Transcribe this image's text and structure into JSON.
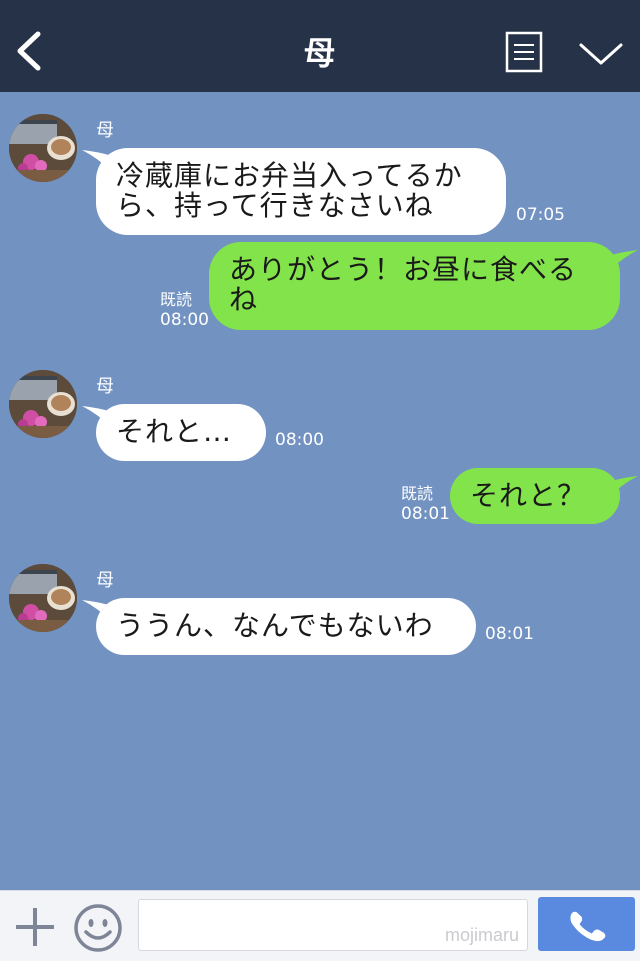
{
  "header": {
    "title": "母",
    "icons": [
      "back-chevron-icon",
      "menu-list-icon",
      "chevron-down-icon"
    ]
  },
  "messages": [
    {
      "direction": "in",
      "sender": "母",
      "lines": [
        "冷蔵庫にお弁当入ってるか",
        "ら、持って行きなさいね"
      ],
      "time": "07:05"
    },
    {
      "direction": "out",
      "lines": [
        "ありがとう！お昼に食べる",
        "ね"
      ],
      "read": "既読",
      "time": "08:00"
    },
    {
      "direction": "in",
      "sender": "母",
      "lines": [
        "それと…"
      ],
      "time": "08:00"
    },
    {
      "direction": "out",
      "lines": [
        "それと？"
      ],
      "read": "既読",
      "time": "08:01"
    },
    {
      "direction": "in",
      "sender": "母",
      "lines": [
        "ううん、なんでもないわ"
      ],
      "time": "08:01"
    }
  ],
  "input_bar": {
    "placeholder": "",
    "watermark": "mojimaru",
    "icons": [
      "plus-icon",
      "emoji-icon",
      "phone-icon"
    ]
  },
  "colors": {
    "header_bg": "#253247",
    "chat_bg": "#7292c2",
    "incoming_bubble": "#ffffff",
    "outgoing_bubble": "#83e34a",
    "call_button": "#5a8ae0"
  }
}
